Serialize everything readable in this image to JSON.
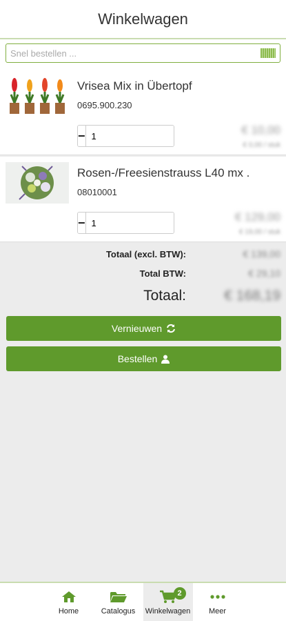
{
  "header": {
    "title": "Winkelwagen"
  },
  "search": {
    "placeholder": "Snel bestellen ...",
    "icon": "barcode-icon"
  },
  "items": [
    {
      "title": "Vrisea Mix in Übertopf",
      "code": "0695.900.230",
      "quantity": "1",
      "price": "€ 10,00",
      "unit_price": "€ 0,00 / stuk"
    },
    {
      "title": "Rosen-/Freesienstrauss L40 mx .",
      "code": "08010001",
      "quantity": "1",
      "price": "€ 129,00",
      "unit_price": "€ 19,00 / stuk"
    }
  ],
  "totals": {
    "excl_label": "Totaal (excl. BTW):",
    "excl_value": "€ 139,00",
    "btw_label": "Total BTW:",
    "btw_value": "€ 29,10",
    "total_label": "Totaal:",
    "total_value": "€ 168,19"
  },
  "actions": {
    "refresh_label": "Vernieuwen",
    "order_label": "Bestellen"
  },
  "tabbar": {
    "tabs": [
      {
        "label": "Home",
        "icon": "home-icon"
      },
      {
        "label": "Catalogus",
        "icon": "folder-open-icon"
      },
      {
        "label": "Winkelwagen",
        "icon": "cart-icon",
        "badge": "2",
        "active": true
      },
      {
        "label": "Meer",
        "icon": "more-icon"
      }
    ]
  },
  "colors": {
    "accent": "#5f9a2c",
    "border_accent": "#c9dcb0"
  }
}
